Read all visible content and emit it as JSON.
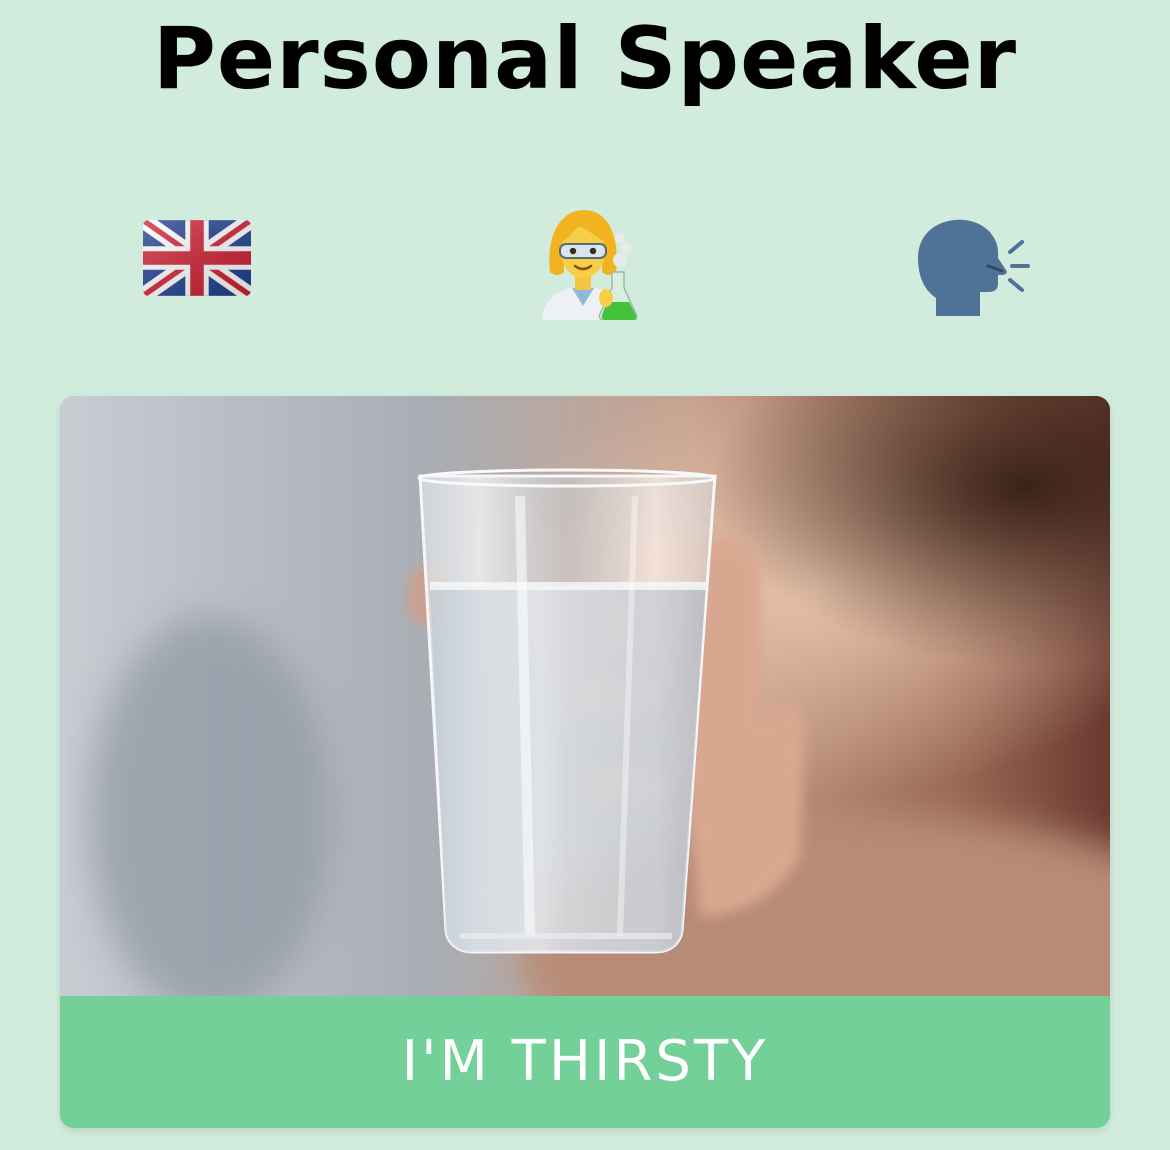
{
  "header": {
    "title": "Personal Speaker"
  },
  "toolbar": {
    "language_icon": "uk-flag-icon",
    "voice_icon": "woman-scientist-icon",
    "speak_icon": "speaking-head-icon"
  },
  "phrase_card": {
    "label": "I'M THIRSTY",
    "image": "glass-of-water-photo"
  },
  "colors": {
    "background": "#d1ebdd",
    "card_label_bg": "#72d098",
    "card_label_text": "#ffffff",
    "title_text": "#000000"
  }
}
